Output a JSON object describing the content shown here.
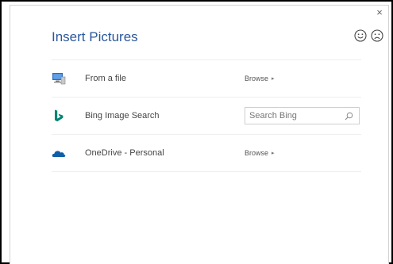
{
  "dialog": {
    "title": "Insert Pictures",
    "close_glyph": "×",
    "feedback": {
      "smile_icon": "smile-icon",
      "frown_icon": "frown-icon"
    }
  },
  "sources": [
    {
      "label": "From a file",
      "icon": "computer-file-icon",
      "action_label": "Browse",
      "action_caret": "▸"
    },
    {
      "label": "Bing Image Search",
      "icon": "bing-icon",
      "search_placeholder": "Search Bing",
      "search_icon": "search-icon"
    },
    {
      "label": "OneDrive - Personal",
      "icon": "onedrive-cloud-icon",
      "action_label": "Browse",
      "action_caret": "▸"
    }
  ],
  "colors": {
    "title": "#2b579a",
    "bing": "#008373",
    "onedrive": "#0f5ea8"
  }
}
